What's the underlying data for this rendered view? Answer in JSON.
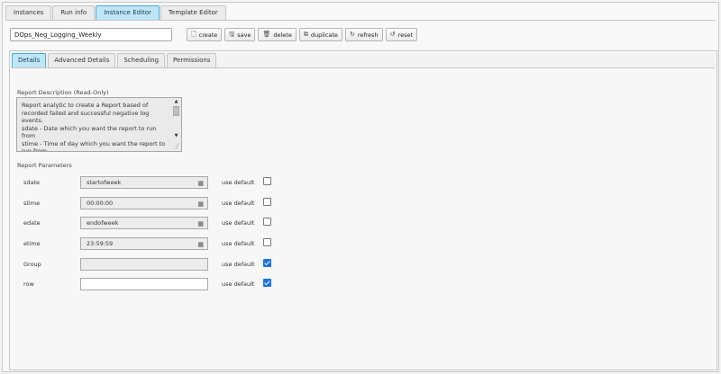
{
  "top_tabs": [
    {
      "label": "Instances"
    },
    {
      "label": "Run info"
    },
    {
      "label": "Instance Editor"
    },
    {
      "label": "Template Editor"
    }
  ],
  "instance_name": "DOps_Neg_Logging_Weekly",
  "toolbar": {
    "create": "create",
    "save": "save",
    "delete": "delete",
    "duplicate": "duplicate",
    "refresh": "refresh",
    "reset": "reset"
  },
  "inner_tabs": [
    {
      "label": "Details"
    },
    {
      "label": "Advanced Details"
    },
    {
      "label": "Scheduling"
    },
    {
      "label": "Permissions"
    }
  ],
  "report_description": {
    "label": "Report Description (Read-Only)",
    "text": "Report analytic to create a Report based of\nrecorded failed and successful negative log events.\nsdate - Date which you want the report to run\nfrom\nstime - Time of day which you want the report to\nrun from"
  },
  "report_parameters": {
    "label": "Report Parameters",
    "use_default_label": "use default",
    "params": [
      {
        "name": "sdate",
        "value": "startofweek",
        "use_default": false
      },
      {
        "name": "stime",
        "value": "00:00:00",
        "use_default": false
      },
      {
        "name": "edate",
        "value": "endofweek",
        "use_default": false
      },
      {
        "name": "etime",
        "value": "23:59:59",
        "use_default": false
      },
      {
        "name": "Group",
        "value": "",
        "use_default": true
      },
      {
        "name": "row",
        "value": "",
        "use_default": true
      }
    ]
  }
}
